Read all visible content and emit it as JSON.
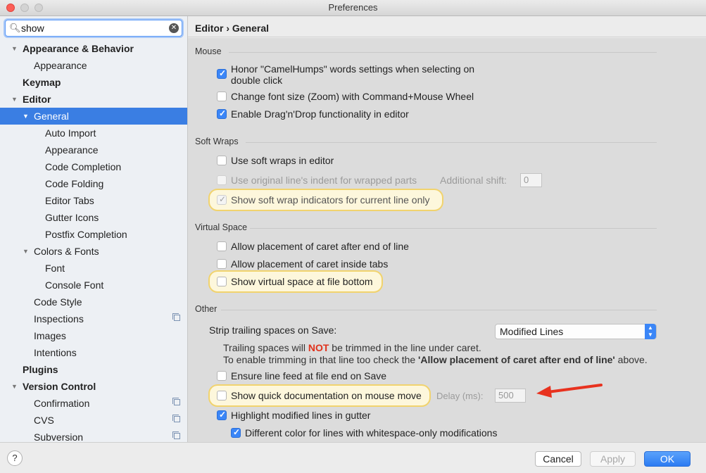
{
  "window": {
    "title": "Preferences"
  },
  "search": {
    "value": "show"
  },
  "tree": [
    {
      "label": "Appearance & Behavior",
      "bold": true,
      "expanded": true
    },
    {
      "label": "Appearance"
    },
    {
      "label": "Keymap",
      "bold": true
    },
    {
      "label": "Editor",
      "bold": true,
      "expanded": true
    },
    {
      "label": "General",
      "selected": true,
      "expanded": true
    },
    {
      "label": "Auto Import"
    },
    {
      "label": "Appearance"
    },
    {
      "label": "Code Completion"
    },
    {
      "label": "Code Folding"
    },
    {
      "label": "Editor Tabs"
    },
    {
      "label": "Gutter Icons"
    },
    {
      "label": "Postfix Completion"
    },
    {
      "label": "Colors & Fonts",
      "expanded": true
    },
    {
      "label": "Font"
    },
    {
      "label": "Console Font"
    },
    {
      "label": "Code Style"
    },
    {
      "label": "Inspections",
      "project": true
    },
    {
      "label": "Images"
    },
    {
      "label": "Intentions"
    },
    {
      "label": "Plugins",
      "bold": true
    },
    {
      "label": "Version Control",
      "bold": true,
      "expanded": true
    },
    {
      "label": "Confirmation",
      "project": true
    },
    {
      "label": "CVS",
      "project": true
    },
    {
      "label": "Subversion",
      "project": true
    }
  ],
  "breadcrumb": "Editor › General",
  "sections": {
    "mouse": "Mouse",
    "soft_wraps": "Soft Wraps",
    "virtual_space": "Virtual Space",
    "other": "Other"
  },
  "options": {
    "camel_humps_line1": "Honor \"CamelHumps\" words settings when selecting on",
    "camel_humps_line2": "double click",
    "change_font_size": "Change font size (Zoom) with Command+Mouse Wheel",
    "drag_drop": "Enable Drag'n'Drop functionality in editor",
    "use_soft_wraps": "Use soft wraps in editor",
    "use_original_indent": "Use original line's indent for wrapped parts",
    "additional_shift_label": "Additional shift:",
    "additional_shift_value": "0",
    "show_soft_wrap_indicators": "Show soft wrap indicators for current line only",
    "caret_after_eol": "Allow placement of caret after end of line",
    "caret_inside_tabs": "Allow placement of caret inside tabs",
    "virtual_space_bottom": "Show virtual space at file bottom",
    "strip_trailing_label": "Strip trailing spaces on Save:",
    "strip_trailing_value": "Modified Lines",
    "note_line1_a": "Trailing spaces will ",
    "note_line1_not": "NOT",
    "note_line1_b": " be trimmed in the line under caret.",
    "note_line2_a": "To enable trimming in that line too check the ",
    "note_line2_bold": "'Allow placement of caret after end of line'",
    "note_line2_b": " above.",
    "line_feed_eof": "Ensure line feed at file end on Save",
    "quick_doc": "Show quick documentation on mouse move",
    "delay_label": "Delay (ms):",
    "delay_value": "500",
    "highlight_modified": "Highlight modified lines in gutter",
    "whitespace_only": "Different color for lines with whitespace-only modifications"
  },
  "buttons": {
    "help": "?",
    "cancel": "Cancel",
    "apply": "Apply",
    "ok": "OK"
  },
  "colors": {
    "accent": "#3a7ee3",
    "highlight": "#f1d36e",
    "arrow": "#e8321f"
  }
}
